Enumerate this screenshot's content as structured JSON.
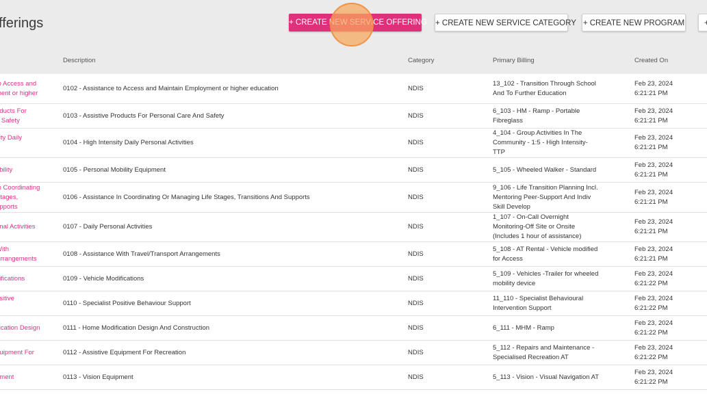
{
  "header": {
    "title": "fferings",
    "buttons": {
      "create_offering": "+ CREATE NEW SERVICE OFFERING",
      "create_category": "+ CREATE NEW SERVICE CATEGORY",
      "create_program": "+ CREATE NEW PROGRAM",
      "more": "+"
    }
  },
  "table": {
    "columns": {
      "description": "Description",
      "category": "Category",
      "billing": "Primary Billing",
      "created": "Created On"
    },
    "rows": [
      {
        "name": [
          "to Access and",
          "ment or higher"
        ],
        "description": "0102 - Assistance to Access and Maintain Employment or higher education",
        "category": "NDIS",
        "billing": [
          "13_102 - Transition Through School",
          "And To Further Education"
        ],
        "date": "Feb 23, 2024",
        "time": "6:21:21 PM"
      },
      {
        "name": [
          "oducts For",
          "d Safety"
        ],
        "description": "0103 - Assistive Products For Personal Care And Safety",
        "category": "NDIS",
        "billing": [
          "6_103 - HM - Ramp - Portable",
          "Fibreglass"
        ],
        "date": "Feb 23, 2024",
        "time": "6:21:21 PM"
      },
      {
        "name": [
          "sity Daily",
          "s"
        ],
        "description": "0104 - High Intensity Daily Personal Activities",
        "category": "NDIS",
        "billing": [
          "4_104 - Group Activities In The",
          "Community - 1:5 - High Intensity-",
          "TTP"
        ],
        "date": "Feb 23, 2024",
        "time": "6:21:21 PM"
      },
      {
        "name": [
          "obility"
        ],
        "description": "0105 - Personal Mobility Equipment",
        "category": "NDIS",
        "billing": [
          "5_105 - Wheeled Walker - Standard"
        ],
        "date": "Feb 23, 2024",
        "time": "6:21:21 PM"
      },
      {
        "name": [
          "In Coordinating",
          "Stages,",
          "upports"
        ],
        "description": "0106 - Assistance In Coordinating Or Managing Life Stages, Transitions And Supports",
        "category": "NDIS",
        "billing": [
          "9_106 - Life Transition Planning Incl.",
          "Mentoring Peer-Support And Indiv",
          "Skill Develop"
        ],
        "date": "Feb 23, 2024",
        "time": "6:21:21 PM"
      },
      {
        "name": [
          "onal Activities"
        ],
        "description": "0107 - Daily Personal Activities",
        "category": "NDIS",
        "billing": [
          "1_107 - On-Call Overnight",
          "Monitoring-Off Site or Onsite",
          "(Includes 1 hour of assistance)"
        ],
        "date": "Feb 23, 2024",
        "time": "6:21:21 PM"
      },
      {
        "name": [
          "With",
          "Arrangements"
        ],
        "description": "0108 - Assistance With Travel/Transport Arrangements",
        "category": "NDIS",
        "billing": [
          "5_108 - AT Rental - Vehicle modified",
          "for Access"
        ],
        "date": "Feb 23, 2024",
        "time": "6:21:21 PM"
      },
      {
        "name": [
          "difications"
        ],
        "description": "0109 - Vehicle Modifications",
        "category": "NDIS",
        "billing": [
          "5_109 - Vehicles -Trailer for wheeled",
          "mobility device"
        ],
        "date": "Feb 23, 2024",
        "time": "6:21:22 PM"
      },
      {
        "name": [
          "ositive",
          "rt"
        ],
        "description": "0110 - Specialist Positive Behaviour Support",
        "category": "NDIS",
        "billing": [
          "11_110 - Specialist Behavioural",
          "Intervention Support"
        ],
        "date": "Feb 23, 2024",
        "time": "6:21:22 PM"
      },
      {
        "name": [
          "ification Design"
        ],
        "description": "0111 - Home Modification Design And Construction",
        "category": "NDIS",
        "billing": [
          "6_111 - MHM - Ramp"
        ],
        "date": "Feb 23, 2024",
        "time": "6:21:22 PM"
      },
      {
        "name": [
          "quipment For"
        ],
        "description": "0112 - Assistive Equipment For Recreation",
        "category": "NDIS",
        "billing": [
          "5_112 - Repairs and Maintenance -",
          "Specialised Recreation AT"
        ],
        "date": "Feb 23, 2024",
        "time": "6:21:22 PM"
      },
      {
        "name": [
          "pment"
        ],
        "description": "0113 - Vision Equipment",
        "category": "NDIS",
        "billing": [
          "5_113 - Vision - Visual Navigation AT"
        ],
        "date": "Feb 23, 2024",
        "time": "6:21:22 PM"
      }
    ]
  },
  "colors": {
    "accent": "#e0307b",
    "link": "#d63384",
    "header_bg": "#ebebeb",
    "click_marker": "#f7a65c"
  }
}
